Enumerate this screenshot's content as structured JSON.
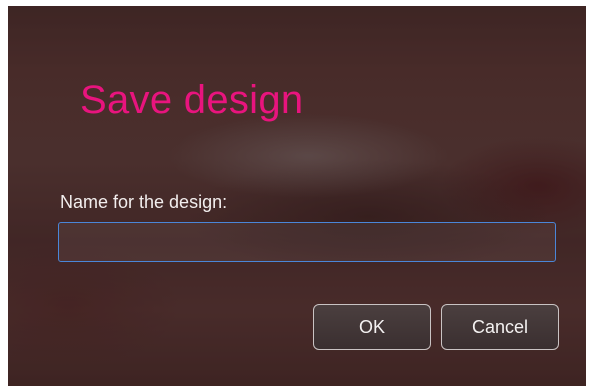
{
  "dialog": {
    "title": "Save design",
    "field_label": "Name for the design:",
    "name_input": {
      "value": "",
      "placeholder": ""
    },
    "ok_label": "OK",
    "cancel_label": "Cancel"
  },
  "colors": {
    "title_accent": "#e8147e",
    "input_focus_border": "#4a86d8"
  }
}
